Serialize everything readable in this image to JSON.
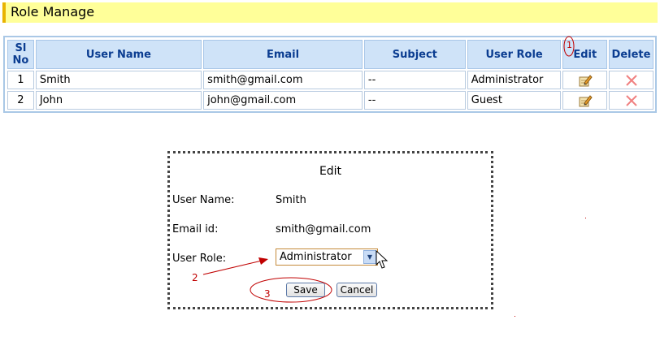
{
  "page": {
    "title": "Role Manage"
  },
  "table": {
    "headers": {
      "sl": "Sl No",
      "user_name": "User Name",
      "email": "Email",
      "subject": "Subject",
      "user_role": "User Role",
      "edit": "Edit",
      "delete": "Delete"
    },
    "rows": [
      {
        "sl": "1",
        "user_name": "Smith",
        "email": "smith@gmail.com",
        "subject": "--",
        "user_role": "Administrator"
      },
      {
        "sl": "2",
        "user_name": "John",
        "email": "john@gmail.com",
        "subject": "--",
        "user_role": "Guest"
      }
    ]
  },
  "dialog": {
    "title": "Edit",
    "user_name_label": "User Name:",
    "user_name_value": "Smith",
    "email_label": "Email id:",
    "email_value": "smith@gmail.com",
    "role_label": "User Role:",
    "role_value": "Administrator",
    "save_label": "Save",
    "cancel_label": "Cancel"
  },
  "annotations": {
    "step1": "1",
    "step2": "2",
    "step3": "3"
  },
  "icons": {
    "edit": "pencil-note-icon",
    "delete": "red-x-icon",
    "dropdown": "chevron-down-icon",
    "cursor": "mouse-pointer-icon"
  },
  "colors": {
    "title_bg": "#ffff99",
    "header_bg": "#cfe3f8",
    "header_text": "#0b3d91",
    "annotation": "#c00000",
    "delete_icon": "#f08080"
  }
}
